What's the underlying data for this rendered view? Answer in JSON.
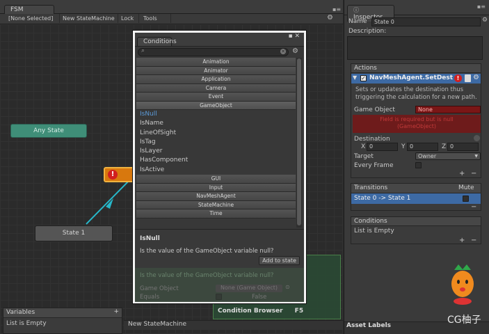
{
  "fsm": {
    "tab": "FSM",
    "toolbar": {
      "selection": "[None Selected]",
      "graph": "New StateMachine",
      "lock": "Lock",
      "tools": "Tools"
    }
  },
  "nodes": {
    "any_state": "Any State",
    "state1": "State 1"
  },
  "variables": {
    "title": "Variables",
    "add": "+",
    "empty": "List is Empty"
  },
  "status": {
    "state_machine": "New StateMachine"
  },
  "shortcuts": {
    "condition_browser": "Condition Browser",
    "key": "F5"
  },
  "conditions": {
    "title": "Conditions",
    "categories_top": [
      "Animation",
      "Animator",
      "Application",
      "Camera",
      "Event",
      "GameObject"
    ],
    "actions": [
      "IsNull",
      "IsName",
      "LineOfSight",
      "IsTag",
      "IsLayer",
      "HasComponent",
      "IsActive"
    ],
    "categories_bottom": [
      "GUI",
      "Input",
      "NavMeshAgent",
      "StateMachine",
      "Time"
    ],
    "detail": {
      "name": "IsNull",
      "description": "Is the value of the GameObject variable null?",
      "add_button": "Add to state",
      "preview_text": "Is the value of the GameObject variable null?",
      "game_object_label": "Game Object",
      "game_object_value": "None (Game Object)",
      "equals_label": "Equals",
      "equals_value": "False"
    }
  },
  "inspector": {
    "tab": "Inspector",
    "name_label": "Name",
    "name_value": "State 0",
    "description_label": "Description:",
    "actions_title": "Actions",
    "action": {
      "title": "NavMeshAgent.SetDestin",
      "description": "Sets or updates the destination thus triggering the calculation for a new path.",
      "game_object_label": "Game Object",
      "game_object_value": "None",
      "error_text": "Field is required but is null (GameObject)",
      "destination_label": "Destination",
      "x_label": "X",
      "x_value": "0",
      "y_label": "Y",
      "y_value": "0",
      "z_label": "Z",
      "z_value": "0",
      "target_label": "Target",
      "target_value": "Owner",
      "every_frame_label": "Every Frame"
    },
    "transitions_title": "Transitions",
    "mute_label": "Mute",
    "transition_item": "State 0 -> State 1",
    "conditions_title": "Conditions",
    "conditions_empty": "List is Empty",
    "plus": "+",
    "minus": "−",
    "asset_labels": "Asset Labels"
  },
  "watermark": {
    "text": "CG柚子"
  },
  "colors": {
    "accent": "#3d6aa4",
    "error": "#cc2222",
    "node_green": "#3f8e78",
    "node_orange": "#d8780e",
    "link": "#27b7c9"
  }
}
